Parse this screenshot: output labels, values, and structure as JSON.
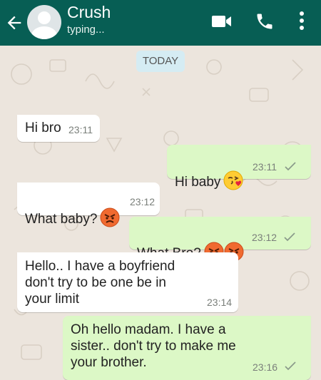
{
  "header": {
    "contact_name": "Crush",
    "status": "typing...",
    "icons": [
      "back-arrow-icon",
      "avatar",
      "video-call-icon",
      "voice-call-icon",
      "more-options-icon"
    ],
    "background_color": "#075e54"
  },
  "chat": {
    "date_chip": "TODAY",
    "messages": [
      {
        "direction": "incoming",
        "text": "Hi bro",
        "time": "23:11"
      },
      {
        "direction": "outgoing",
        "text": "Hi baby",
        "emoji": "face-blowing-kiss",
        "time": "23:11",
        "status": "sent"
      },
      {
        "direction": "incoming",
        "text": "What baby?",
        "emoji": "angry-face",
        "time": "23:12"
      },
      {
        "direction": "outgoing",
        "text": "What Bro?",
        "emoji": "angry-face x2",
        "time": "23:12",
        "status": "sent"
      },
      {
        "direction": "incoming",
        "text": "Hello.. I have a boyfriend\ndon't try to be one be in\nyour limit",
        "time": "23:14"
      },
      {
        "direction": "outgoing",
        "text": "Oh hello madam. I have a\nsister.. don't try to make me\nyour brother.",
        "time": "23:16",
        "status": "sent"
      }
    ]
  },
  "colors": {
    "incoming_bubble": "#ffffff",
    "outgoing_bubble": "#dcf8c6",
    "wallpaper": "#ece5dd",
    "date_chip": "#d5ecf3"
  }
}
